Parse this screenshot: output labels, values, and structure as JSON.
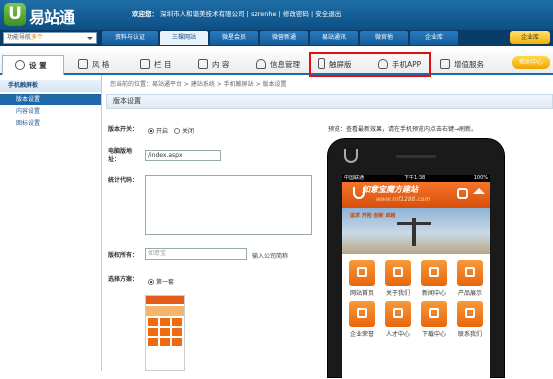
{
  "header": {
    "logo_letter": "U",
    "logo_text": "易站通",
    "welcome_prefix": "欢迎您：",
    "company": "深圳市人和谐美技术有限公司",
    "sep1": "|",
    "username": "szrenhe",
    "sep2": "|",
    "change_password": "修改密码",
    "sep3": "|",
    "logout": "安全退出"
  },
  "topnav": {
    "function_nav": "功能导航",
    "function_nav_suffix": "多个",
    "items": [
      {
        "label": "资料与认证"
      },
      {
        "label": "三棵网站"
      },
      {
        "label": "微星会员"
      },
      {
        "label": "微营新通"
      },
      {
        "label": "易站通讯"
      },
      {
        "label": "微官他"
      },
      {
        "label": "企业库"
      }
    ],
    "user_button": "企业库"
  },
  "tabs": {
    "items": [
      {
        "label": "设 置",
        "icon": "gear-icon"
      },
      {
        "label": "风 格",
        "icon": "style-icon"
      },
      {
        "label": "栏 目",
        "icon": "column-icon"
      },
      {
        "label": "内 容",
        "icon": "content-icon"
      },
      {
        "label": "信息管理",
        "icon": "info-icon"
      },
      {
        "label": "触屏版",
        "icon": "mobile-icon"
      },
      {
        "label": "手机APP",
        "icon": "app-icon"
      },
      {
        "label": "增值服务",
        "icon": "service-icon"
      }
    ],
    "help_button": "帮助中心"
  },
  "sidebar": {
    "heading": "手机触屏板",
    "items": [
      {
        "label": "版本设置"
      },
      {
        "label": "内容设置"
      },
      {
        "label": "图标设置"
      }
    ]
  },
  "breadcrumb": "您当前的位置：易站通平台 > 建站系统 > 手机触屏站 > 版本设置",
  "panel": {
    "title": "版本设置",
    "switch_label": "版本开关：",
    "on_label": "开启",
    "off_label": "关闭",
    "pc_addr_label": "电脑版地址：",
    "pc_addr_value": "/index.aspx",
    "stats_label": "统计代码：",
    "copyright_label": "版权所有：",
    "copyright_placeholder": "如意宝",
    "copyright_hint": "输入公司简称",
    "scheme_label": "选择方案：",
    "scheme_option": "第一套"
  },
  "preview": {
    "hint": "预览：查看最新效果，请在手机预览内点击右键→刷新。",
    "status_carrier": "中国联通",
    "status_time": "下午1:38",
    "status_battery": "100%",
    "site_name": "如意宝魔方建站",
    "site_url": "www.mf1288.com",
    "banner_text": "追求 开拓 创新 卓越",
    "icons": [
      {
        "label": "网站首页",
        "icon": "home-icon"
      },
      {
        "label": "关于我们",
        "icon": "about-icon"
      },
      {
        "label": "新闻中心",
        "icon": "news-icon"
      },
      {
        "label": "产品展示",
        "icon": "product-icon"
      },
      {
        "label": "企业荣誉",
        "icon": "honor-icon"
      },
      {
        "label": "人才中心",
        "icon": "talent-icon"
      },
      {
        "label": "下载中心",
        "icon": "download-icon"
      },
      {
        "label": "联系我们",
        "icon": "contact-icon"
      }
    ]
  },
  "colors": {
    "header_blue": "#0c4f85",
    "highlight_red": "#e01010",
    "mobile_orange": "#e8660c"
  }
}
